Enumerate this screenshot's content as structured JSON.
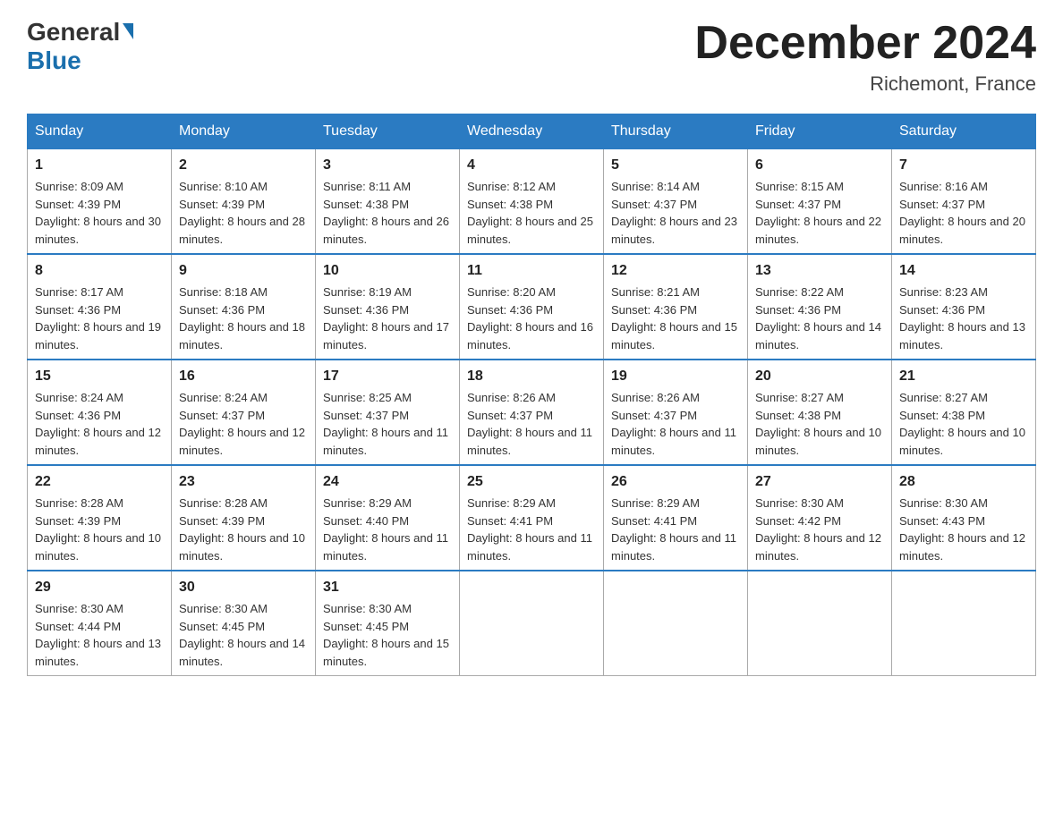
{
  "header": {
    "logo_general": "General",
    "logo_blue": "Blue",
    "title": "December 2024",
    "location": "Richemont, France"
  },
  "days_of_week": [
    "Sunday",
    "Monday",
    "Tuesday",
    "Wednesday",
    "Thursday",
    "Friday",
    "Saturday"
  ],
  "weeks": [
    [
      {
        "day": "1",
        "sunrise": "Sunrise: 8:09 AM",
        "sunset": "Sunset: 4:39 PM",
        "daylight": "Daylight: 8 hours and 30 minutes."
      },
      {
        "day": "2",
        "sunrise": "Sunrise: 8:10 AM",
        "sunset": "Sunset: 4:39 PM",
        "daylight": "Daylight: 8 hours and 28 minutes."
      },
      {
        "day": "3",
        "sunrise": "Sunrise: 8:11 AM",
        "sunset": "Sunset: 4:38 PM",
        "daylight": "Daylight: 8 hours and 26 minutes."
      },
      {
        "day": "4",
        "sunrise": "Sunrise: 8:12 AM",
        "sunset": "Sunset: 4:38 PM",
        "daylight": "Daylight: 8 hours and 25 minutes."
      },
      {
        "day": "5",
        "sunrise": "Sunrise: 8:14 AM",
        "sunset": "Sunset: 4:37 PM",
        "daylight": "Daylight: 8 hours and 23 minutes."
      },
      {
        "day": "6",
        "sunrise": "Sunrise: 8:15 AM",
        "sunset": "Sunset: 4:37 PM",
        "daylight": "Daylight: 8 hours and 22 minutes."
      },
      {
        "day": "7",
        "sunrise": "Sunrise: 8:16 AM",
        "sunset": "Sunset: 4:37 PM",
        "daylight": "Daylight: 8 hours and 20 minutes."
      }
    ],
    [
      {
        "day": "8",
        "sunrise": "Sunrise: 8:17 AM",
        "sunset": "Sunset: 4:36 PM",
        "daylight": "Daylight: 8 hours and 19 minutes."
      },
      {
        "day": "9",
        "sunrise": "Sunrise: 8:18 AM",
        "sunset": "Sunset: 4:36 PM",
        "daylight": "Daylight: 8 hours and 18 minutes."
      },
      {
        "day": "10",
        "sunrise": "Sunrise: 8:19 AM",
        "sunset": "Sunset: 4:36 PM",
        "daylight": "Daylight: 8 hours and 17 minutes."
      },
      {
        "day": "11",
        "sunrise": "Sunrise: 8:20 AM",
        "sunset": "Sunset: 4:36 PM",
        "daylight": "Daylight: 8 hours and 16 minutes."
      },
      {
        "day": "12",
        "sunrise": "Sunrise: 8:21 AM",
        "sunset": "Sunset: 4:36 PM",
        "daylight": "Daylight: 8 hours and 15 minutes."
      },
      {
        "day": "13",
        "sunrise": "Sunrise: 8:22 AM",
        "sunset": "Sunset: 4:36 PM",
        "daylight": "Daylight: 8 hours and 14 minutes."
      },
      {
        "day": "14",
        "sunrise": "Sunrise: 8:23 AM",
        "sunset": "Sunset: 4:36 PM",
        "daylight": "Daylight: 8 hours and 13 minutes."
      }
    ],
    [
      {
        "day": "15",
        "sunrise": "Sunrise: 8:24 AM",
        "sunset": "Sunset: 4:36 PM",
        "daylight": "Daylight: 8 hours and 12 minutes."
      },
      {
        "day": "16",
        "sunrise": "Sunrise: 8:24 AM",
        "sunset": "Sunset: 4:37 PM",
        "daylight": "Daylight: 8 hours and 12 minutes."
      },
      {
        "day": "17",
        "sunrise": "Sunrise: 8:25 AM",
        "sunset": "Sunset: 4:37 PM",
        "daylight": "Daylight: 8 hours and 11 minutes."
      },
      {
        "day": "18",
        "sunrise": "Sunrise: 8:26 AM",
        "sunset": "Sunset: 4:37 PM",
        "daylight": "Daylight: 8 hours and 11 minutes."
      },
      {
        "day": "19",
        "sunrise": "Sunrise: 8:26 AM",
        "sunset": "Sunset: 4:37 PM",
        "daylight": "Daylight: 8 hours and 11 minutes."
      },
      {
        "day": "20",
        "sunrise": "Sunrise: 8:27 AM",
        "sunset": "Sunset: 4:38 PM",
        "daylight": "Daylight: 8 hours and 10 minutes."
      },
      {
        "day": "21",
        "sunrise": "Sunrise: 8:27 AM",
        "sunset": "Sunset: 4:38 PM",
        "daylight": "Daylight: 8 hours and 10 minutes."
      }
    ],
    [
      {
        "day": "22",
        "sunrise": "Sunrise: 8:28 AM",
        "sunset": "Sunset: 4:39 PM",
        "daylight": "Daylight: 8 hours and 10 minutes."
      },
      {
        "day": "23",
        "sunrise": "Sunrise: 8:28 AM",
        "sunset": "Sunset: 4:39 PM",
        "daylight": "Daylight: 8 hours and 10 minutes."
      },
      {
        "day": "24",
        "sunrise": "Sunrise: 8:29 AM",
        "sunset": "Sunset: 4:40 PM",
        "daylight": "Daylight: 8 hours and 11 minutes."
      },
      {
        "day": "25",
        "sunrise": "Sunrise: 8:29 AM",
        "sunset": "Sunset: 4:41 PM",
        "daylight": "Daylight: 8 hours and 11 minutes."
      },
      {
        "day": "26",
        "sunrise": "Sunrise: 8:29 AM",
        "sunset": "Sunset: 4:41 PM",
        "daylight": "Daylight: 8 hours and 11 minutes."
      },
      {
        "day": "27",
        "sunrise": "Sunrise: 8:30 AM",
        "sunset": "Sunset: 4:42 PM",
        "daylight": "Daylight: 8 hours and 12 minutes."
      },
      {
        "day": "28",
        "sunrise": "Sunrise: 8:30 AM",
        "sunset": "Sunset: 4:43 PM",
        "daylight": "Daylight: 8 hours and 12 minutes."
      }
    ],
    [
      {
        "day": "29",
        "sunrise": "Sunrise: 8:30 AM",
        "sunset": "Sunset: 4:44 PM",
        "daylight": "Daylight: 8 hours and 13 minutes."
      },
      {
        "day": "30",
        "sunrise": "Sunrise: 8:30 AM",
        "sunset": "Sunset: 4:45 PM",
        "daylight": "Daylight: 8 hours and 14 minutes."
      },
      {
        "day": "31",
        "sunrise": "Sunrise: 8:30 AM",
        "sunset": "Sunset: 4:45 PM",
        "daylight": "Daylight: 8 hours and 15 minutes."
      },
      null,
      null,
      null,
      null
    ]
  ]
}
